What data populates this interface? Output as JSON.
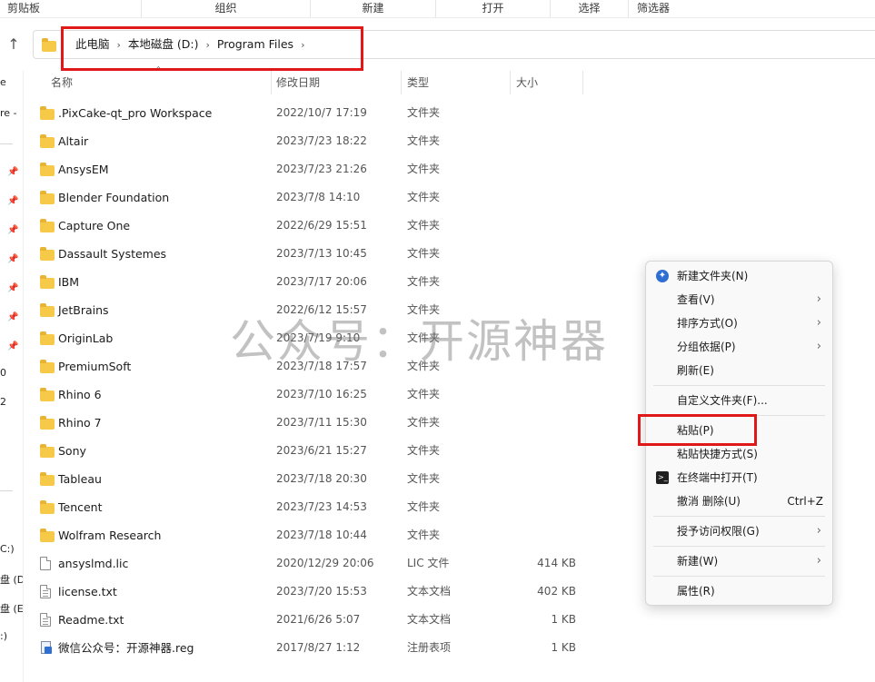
{
  "ribbon": {
    "groups": [
      "剪贴板",
      "组织",
      "新建",
      "打开",
      "选择",
      "筛选器"
    ]
  },
  "address": {
    "crumbs": [
      "此电脑",
      "本地磁盘 (D:)",
      "Program Files"
    ],
    "separator": "›",
    "up_glyph": "↑"
  },
  "nav": {
    "fragments": [
      "e",
      "re -",
      "0",
      "2",
      "C:)",
      "盘 (D",
      "盘 (E",
      ":)"
    ]
  },
  "columns": {
    "name": "名称",
    "date": "修改日期",
    "type": "类型",
    "size": "大小"
  },
  "files": [
    {
      "name": ".PixCake-qt_pro Workspace",
      "date": "2022/10/7 17:19",
      "type": "文件夹",
      "size": "",
      "kind": "folder"
    },
    {
      "name": "Altair",
      "date": "2023/7/23 18:22",
      "type": "文件夹",
      "size": "",
      "kind": "folder"
    },
    {
      "name": "AnsysEM",
      "date": "2023/7/23 21:26",
      "type": "文件夹",
      "size": "",
      "kind": "folder"
    },
    {
      "name": "Blender Foundation",
      "date": "2023/7/8 14:10",
      "type": "文件夹",
      "size": "",
      "kind": "folder"
    },
    {
      "name": "Capture One",
      "date": "2022/6/29 15:51",
      "type": "文件夹",
      "size": "",
      "kind": "folder"
    },
    {
      "name": "Dassault Systemes",
      "date": "2023/7/13 10:45",
      "type": "文件夹",
      "size": "",
      "kind": "folder"
    },
    {
      "name": "IBM",
      "date": "2023/7/17 20:06",
      "type": "文件夹",
      "size": "",
      "kind": "folder"
    },
    {
      "name": "JetBrains",
      "date": "2022/6/12 15:57",
      "type": "文件夹",
      "size": "",
      "kind": "folder"
    },
    {
      "name": "OriginLab",
      "date": "2023/7/19 9:10",
      "type": "文件夹",
      "size": "",
      "kind": "folder"
    },
    {
      "name": "PremiumSoft",
      "date": "2023/7/18 17:57",
      "type": "文件夹",
      "size": "",
      "kind": "folder"
    },
    {
      "name": "Rhino 6",
      "date": "2023/7/10 16:25",
      "type": "文件夹",
      "size": "",
      "kind": "folder"
    },
    {
      "name": "Rhino 7",
      "date": "2023/7/11 15:30",
      "type": "文件夹",
      "size": "",
      "kind": "folder"
    },
    {
      "name": "Sony",
      "date": "2023/6/21 15:27",
      "type": "文件夹",
      "size": "",
      "kind": "folder"
    },
    {
      "name": "Tableau",
      "date": "2023/7/18 20:30",
      "type": "文件夹",
      "size": "",
      "kind": "folder"
    },
    {
      "name": "Tencent",
      "date": "2023/7/23 14:53",
      "type": "文件夹",
      "size": "",
      "kind": "folder"
    },
    {
      "name": "Wolfram Research",
      "date": "2023/7/18 10:44",
      "type": "文件夹",
      "size": "",
      "kind": "folder"
    },
    {
      "name": "ansyslmd.lic",
      "date": "2020/12/29 20:06",
      "type": "LIC 文件",
      "size": "414 KB",
      "kind": "file"
    },
    {
      "name": "license.txt",
      "date": "2023/7/20 15:53",
      "type": "文本文档",
      "size": "402 KB",
      "kind": "text"
    },
    {
      "name": "Readme.txt",
      "date": "2021/6/26 5:07",
      "type": "文本文档",
      "size": "1 KB",
      "kind": "text"
    },
    {
      "name": "微信公众号：开源神器.reg",
      "date": "2017/8/27 1:12",
      "type": "注册表项",
      "size": "1 KB",
      "kind": "reg"
    }
  ],
  "watermark": "公众号：开源神器",
  "context_menu": {
    "new_folder": "新建文件夹(N)",
    "view": "查看(V)",
    "sort": "排序方式(O)",
    "group": "分组依据(P)",
    "refresh": "刷新(E)",
    "customize": "自定义文件夹(F)...",
    "paste": "粘贴(P)",
    "paste_shortcut": "粘贴快捷方式(S)",
    "open_terminal": "在终端中打开(T)",
    "undo": "撤消 删除(U)",
    "undo_shortcut": "Ctrl+Z",
    "give_access": "授予访问权限(G)",
    "new": "新建(W)",
    "properties": "属性(R)",
    "submenu_arrow": "›"
  },
  "colors": {
    "folder": "#f7c948",
    "highlight_box": "#e01818",
    "accent": "#2f6fd1"
  }
}
